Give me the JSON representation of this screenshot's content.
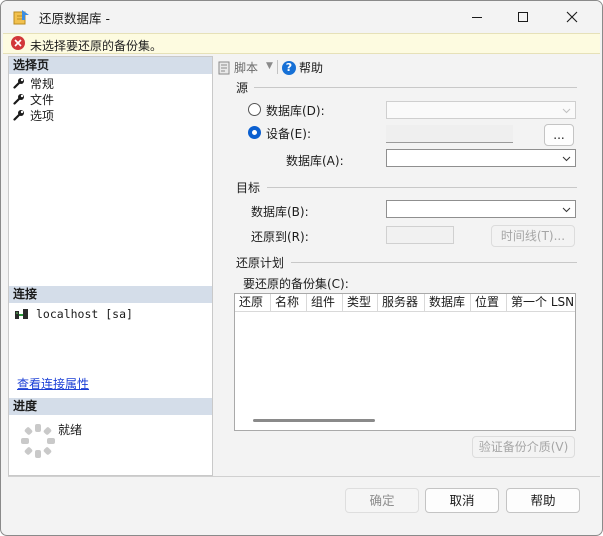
{
  "window": {
    "title": "还原数据库 -"
  },
  "error": {
    "message": "未选择要还原的备份集。"
  },
  "left_panel": {
    "select_page_title": "选择页",
    "pages": [
      {
        "label": "常规",
        "icon": "wrench-icon"
      },
      {
        "label": "文件",
        "icon": "wrench-icon"
      },
      {
        "label": "选项",
        "icon": "wrench-icon"
      }
    ],
    "connection_title": "连接",
    "connection_server": "localhost [sa]",
    "view_connection_link": "查看连接属性",
    "progress_title": "进度",
    "progress_status": "就绪"
  },
  "toolbar": {
    "script_label": "脚本",
    "help_label": "帮助"
  },
  "source": {
    "title": "源",
    "database_radio_label": "数据库(D):",
    "device_radio_label": "设备(E):",
    "selected": "device",
    "browse_label": "...",
    "device_database_label": "数据库(A):"
  },
  "target": {
    "title": "目标",
    "database_label": "数据库(B):",
    "restore_to_label": "还原到(R):",
    "timeline_button": "时间线(T)..."
  },
  "restore_plan": {
    "title": "还原计划",
    "backup_sets_label": "要还原的备份集(C):",
    "columns": [
      "还原",
      "名称",
      "组件",
      "类型",
      "服务器",
      "数据库",
      "位置",
      "第一个 LSN"
    ],
    "verify_button": "验证备份介质(V)"
  },
  "footer": {
    "ok_label": "确定",
    "cancel_label": "取消",
    "help_label": "帮助"
  },
  "colors": {
    "section_header": "#d4dde9",
    "error_bg": "#fdfbe0",
    "radio_selected": "#0a5fd0",
    "link": "#1b3fd6"
  }
}
